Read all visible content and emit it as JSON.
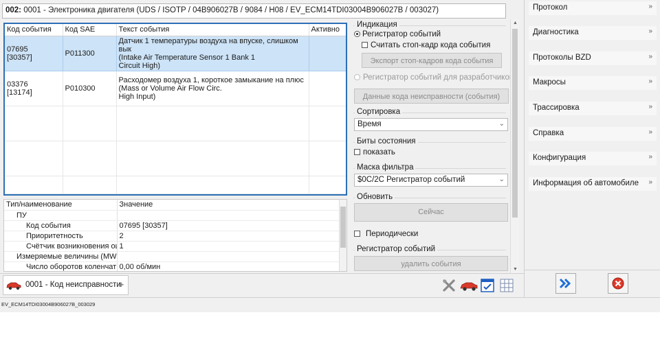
{
  "title": {
    "prefix": "002:",
    "text": " 0001 - Электроника двигателя  (UDS / ISOTP / 04B906027B / 9084 / H08 / EV_ECM14TDI03004B906027B / 003027)"
  },
  "events_table": {
    "headers": [
      "Код события",
      "Код SAE",
      "Текст события",
      "Активно"
    ],
    "rows": [
      {
        "code": "07695\n[30357]",
        "sae": "P011300",
        "text": "Датчик 1 температуры воздуха на впуске, слишком вык\n(Intake Air Temperature Sensor 1 Bank 1\nCircuit High)",
        "active": ""
      },
      {
        "code": "03376\n[13174]",
        "sae": "P010300",
        "text": "Расходомер воздуха 1, короткое замыкание на плюс\n(Mass or Volume Air Flow Circ.\nHigh Input)",
        "active": ""
      }
    ]
  },
  "details": {
    "headers": [
      "Тип/наименование",
      "Значение"
    ],
    "rows": [
      {
        "k": "ПУ",
        "v": ""
      },
      {
        "k": "Код события",
        "v": "07695 [30357]"
      },
      {
        "k": "Приоритетность",
        "v": "2"
      },
      {
        "k": "Счётчик возникновения ош",
        "v": "1"
      },
      {
        "k": "Измеряемые величины (MW",
        "v": ""
      },
      {
        "k": "Число оборотов коленчат",
        "v": "0,00 об/мин"
      }
    ]
  },
  "panel": {
    "indication_label": "Индикация",
    "event_recorder_radio": "Регистратор событий",
    "read_freeze_frame": "Считать стоп-кадр кода события",
    "export_freeze_frames": "Экспорт стоп-кадров кода события",
    "dev_event_recorder": "Регистратор событий для разработчиков",
    "fault_code_data": "Данные кода неисправности (события)",
    "sort_label": "Сортировка",
    "sort_value": "Время",
    "status_bits_label": "Биты состояния",
    "show_label": "показать",
    "filter_mask_label": "Маска фильтра",
    "filter_mask_value": "$0C/2C Регистратор событий",
    "refresh_label": "Обновить",
    "now_button": "Сейчас",
    "periodic_label": "Периодически",
    "recorder_label": "Регистратор событий",
    "delete_events": "удалить события"
  },
  "sidebar": {
    "items": [
      "Протокол",
      "Диагностика",
      "Протоколы BZD",
      "Макросы",
      "Трассировка",
      "Справка",
      "Конфигурация",
      "Информация об автомобиле"
    ]
  },
  "tab": {
    "label": "0001 - Код неисправности"
  },
  "status": {
    "text": "EV_ECM14TDI03004B906027B_003029"
  },
  "colors": {
    "selection": "#cde3f7",
    "accent": "#2b6fb5",
    "close_red": "#e03a2a",
    "forward_blue": "#1f6fd6"
  }
}
